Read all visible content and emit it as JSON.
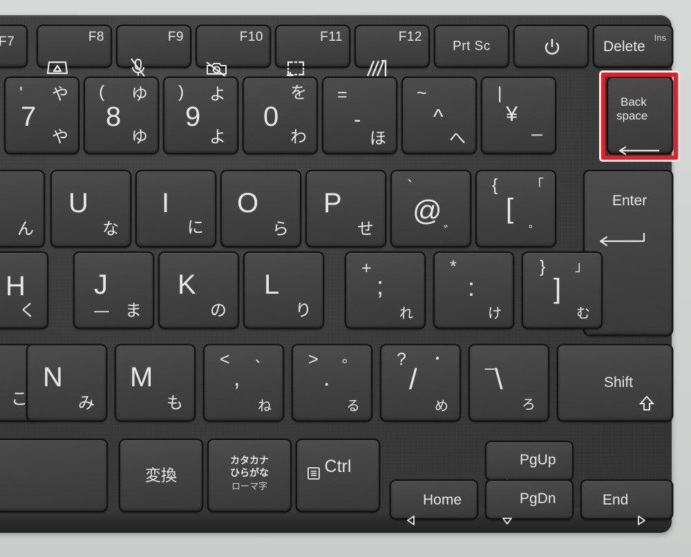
{
  "device": {
    "type": "laptop-keyboard",
    "layout": "Japanese JIS",
    "chassis_color": "#cbcdcc",
    "deck_color": "#3d3d3d",
    "key_color": "#434343",
    "legend_color": "#e9e9e9",
    "highlight_color": "#ec1c24",
    "highlight_outline_color": "#f2f2f2",
    "highlighted_key": "Backspace"
  },
  "function_row": [
    {
      "name": "f7",
      "label": "F7",
      "icon": ""
    },
    {
      "name": "f8",
      "label": "F8",
      "icon": "external-display-icon"
    },
    {
      "name": "f9",
      "label": "F9",
      "icon": "microphone-mute-icon"
    },
    {
      "name": "f10",
      "label": "F10",
      "icon": "camera-off-icon"
    },
    {
      "name": "f11",
      "label": "F11",
      "icon": "snip-select-icon"
    },
    {
      "name": "f12",
      "label": "F12",
      "icon": "touchpad-toggle-icon"
    },
    {
      "name": "prtsc",
      "label": "Prt Sc",
      "icon": ""
    },
    {
      "name": "power",
      "label": "",
      "icon": "power-icon"
    },
    {
      "name": "delete",
      "label": "Delete",
      "icon": "",
      "shift_label": "Ins"
    }
  ],
  "number_row": [
    {
      "name": "key-7",
      "shift": "'",
      "main": "7",
      "kana_top": "や",
      "kana_bottom": "や"
    },
    {
      "name": "key-8",
      "shift": "(",
      "main": "8",
      "kana_top": "ゆ",
      "kana_bottom": "ゆ"
    },
    {
      "name": "key-9",
      "shift": ")",
      "main": "9",
      "kana_top": "よ",
      "kana_bottom": "よ"
    },
    {
      "name": "key-0",
      "shift": "",
      "main": "0",
      "kana_top": "を",
      "kana_bottom": "わ"
    },
    {
      "name": "key-minus",
      "shift": "=",
      "main": "-",
      "kana_top": "",
      "kana_bottom": "ほ"
    },
    {
      "name": "key-caret",
      "shift": "~",
      "main": "^",
      "kana_top": "",
      "kana_bottom": "へ"
    },
    {
      "name": "key-yen",
      "shift": "|",
      "main": "¥",
      "kana_top": "",
      "kana_bottom": "ー"
    },
    {
      "name": "key-backspace",
      "label_line1": "Back",
      "label_line2": "space",
      "icon": "left-arrow-icon"
    }
  ],
  "qwerty_row": [
    {
      "name": "key-y",
      "main": "",
      "kana": "ん",
      "partial": true
    },
    {
      "name": "key-u",
      "main": "U",
      "kana": "な"
    },
    {
      "name": "key-i",
      "main": "I",
      "kana": "に"
    },
    {
      "name": "key-o",
      "main": "O",
      "kana": "ら"
    },
    {
      "name": "key-p",
      "main": "P",
      "kana": "せ"
    },
    {
      "name": "key-at",
      "shift": "`",
      "main": "@",
      "kana_top": "",
      "kana_bottom": "゛"
    },
    {
      "name": "key-bracket-left",
      "shift": "{",
      "main": "[",
      "kana_top": "「",
      "kana_bottom": "゜"
    },
    {
      "name": "key-enter",
      "label": "Enter",
      "icon": "enter-arrow-icon"
    }
  ],
  "home_row": [
    {
      "name": "key-h",
      "main": "H",
      "kana": "く",
      "partial": true
    },
    {
      "name": "key-j",
      "main": "J",
      "kana": "ま",
      "homing_bar": true
    },
    {
      "name": "key-k",
      "main": "K",
      "kana": "の"
    },
    {
      "name": "key-l",
      "main": "L",
      "kana": "り"
    },
    {
      "name": "key-semicolon",
      "shift": "+",
      "main": ";",
      "kana_bottom": "れ"
    },
    {
      "name": "key-colon",
      "shift": "*",
      "main": ":",
      "kana_bottom": "け"
    },
    {
      "name": "key-bracket-right",
      "shift": "}",
      "main": "]",
      "kana_top": "」",
      "kana_bottom": "む"
    }
  ],
  "shift_row": [
    {
      "name": "key-b",
      "main": "",
      "kana": "こ",
      "partial": true
    },
    {
      "name": "key-n",
      "main": "N",
      "kana": "み"
    },
    {
      "name": "key-m",
      "main": "M",
      "kana": "も"
    },
    {
      "name": "key-comma",
      "shift": "<",
      "main": ",",
      "kana_top": "、",
      "kana_bottom": "ね"
    },
    {
      "name": "key-period",
      "shift": ">",
      "main": ".",
      "kana_top": "。",
      "kana_bottom": "る"
    },
    {
      "name": "key-slash",
      "shift": "?",
      "main": "/",
      "kana_top": "・",
      "kana_bottom": "め"
    },
    {
      "name": "key-backslash",
      "shift": "_",
      "main": "\\",
      "kana_top": "",
      "kana_bottom": "ろ"
    },
    {
      "name": "key-shift-right",
      "label": "Shift",
      "icon": "shift-up-icon"
    }
  ],
  "bottom_row": [
    {
      "name": "key-space",
      "label": ""
    },
    {
      "name": "key-henkan",
      "label": "変換"
    },
    {
      "name": "key-katakana-hiragana",
      "line1": "カタカナ",
      "line2": "ひらがな",
      "line3": "ローマ字"
    },
    {
      "name": "key-ctrl-right",
      "label": "Ctrl",
      "icon": "context-menu-icon"
    },
    {
      "name": "key-left-home",
      "label": "Home",
      "icon": "left-triangle-icon"
    },
    {
      "name": "key-up-pgup",
      "label": "PgUp",
      "icon": "up-triangle-icon"
    },
    {
      "name": "key-down-pgdn",
      "label": "PgDn",
      "icon": "down-triangle-icon"
    },
    {
      "name": "key-right-end",
      "label": "End",
      "icon": "right-triangle-icon"
    }
  ]
}
